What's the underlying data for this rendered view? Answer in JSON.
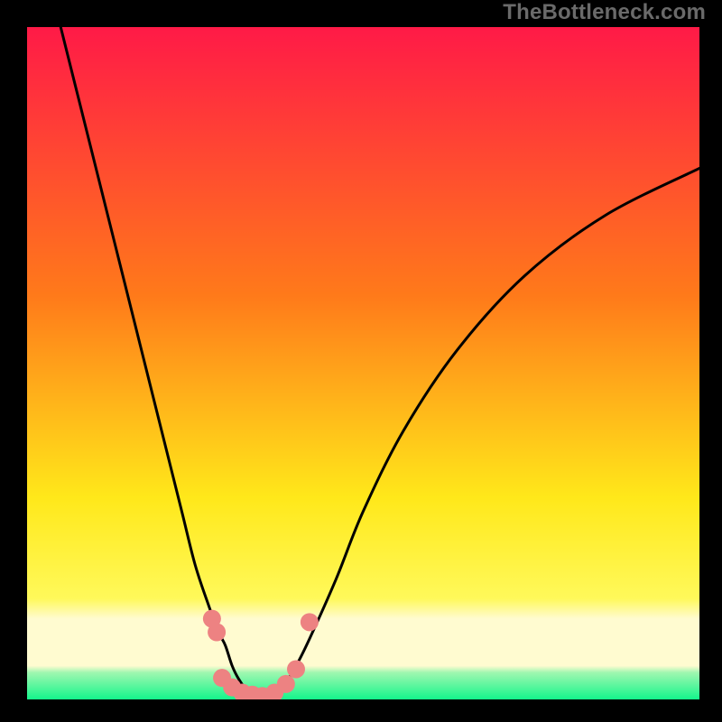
{
  "watermark": "TheBottleneck.com",
  "colors": {
    "frame_bg": "#000000",
    "grad_top": "#ff1a47",
    "grad_mid1": "#ff7a1a",
    "grad_mid2": "#ffe81a",
    "grad_bottom_yellow": "#fffbd0",
    "grad_bottom_green": "#14f58b",
    "curve": "#000000",
    "marker": "#ed8282"
  },
  "chart_data": {
    "type": "line",
    "title": "",
    "xlabel": "",
    "ylabel": "",
    "xlim": [
      0,
      100
    ],
    "ylim": [
      0,
      100
    ],
    "series": [
      {
        "name": "bottleneck-curve-left",
        "x": [
          5,
          8,
          12,
          16,
          20,
          23,
          25,
          27,
          28.5,
          29.5,
          30.5,
          31.5,
          33,
          35
        ],
        "y": [
          100,
          88,
          72,
          56,
          40,
          28,
          20,
          14,
          10,
          8,
          5,
          3,
          1,
          0
        ]
      },
      {
        "name": "bottleneck-curve-right",
        "x": [
          35,
          38,
          40,
          42,
          46,
          50,
          56,
          64,
          74,
          86,
          100
        ],
        "y": [
          0,
          2,
          5,
          9,
          18,
          28,
          40,
          52,
          63,
          72,
          79
        ]
      }
    ],
    "markers": {
      "name": "highlight-points",
      "points": [
        {
          "x": 27.5,
          "y": 12
        },
        {
          "x": 28.2,
          "y": 10
        },
        {
          "x": 29.0,
          "y": 3.2
        },
        {
          "x": 30.5,
          "y": 1.8
        },
        {
          "x": 32.0,
          "y": 1.0
        },
        {
          "x": 33.5,
          "y": 0.7
        },
        {
          "x": 35.0,
          "y": 0.5
        },
        {
          "x": 36.8,
          "y": 1.0
        },
        {
          "x": 38.5,
          "y": 2.3
        },
        {
          "x": 40.0,
          "y": 4.5
        },
        {
          "x": 42.0,
          "y": 11.5
        }
      ]
    },
    "gradient_zones": [
      {
        "y_from": 100,
        "y_to": 13,
        "desc": "red-to-yellow vertical gradient"
      },
      {
        "y_from": 13,
        "y_to": 5,
        "desc": "pale yellow band"
      },
      {
        "y_from": 5,
        "y_to": 0,
        "desc": "thin green strip at bottom"
      }
    ]
  }
}
